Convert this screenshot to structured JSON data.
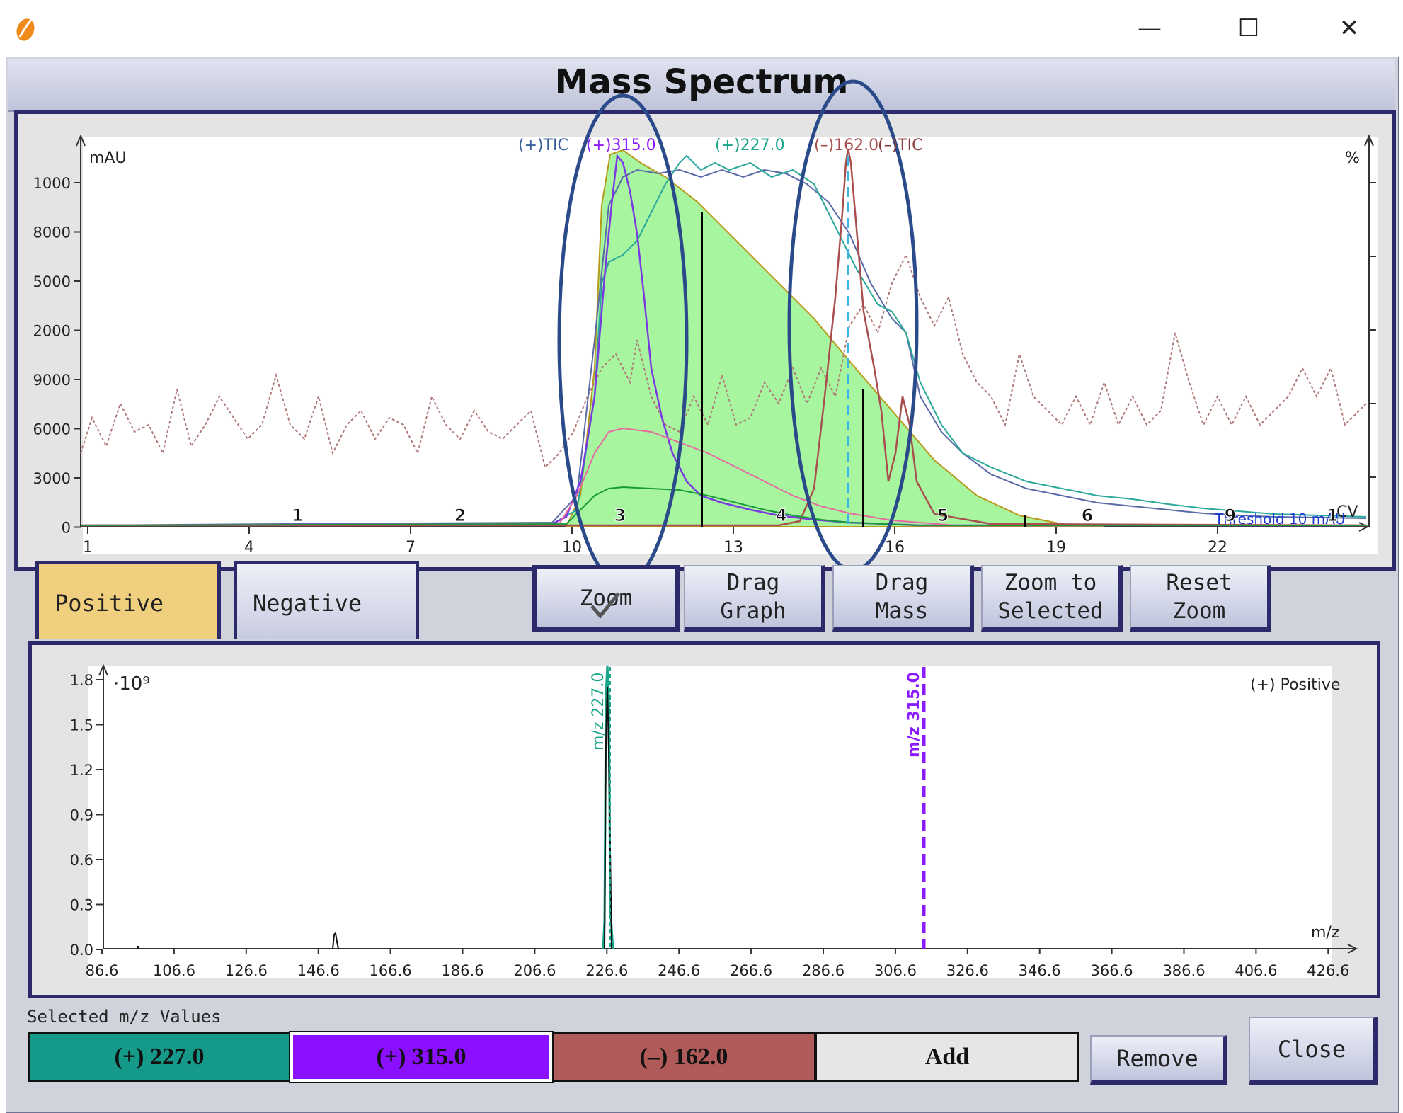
{
  "window": {
    "title": "Mass Spectrum",
    "min_glyph": "—",
    "max_glyph": "☐",
    "close_glyph": "✕"
  },
  "chromatogram": {
    "y_unit_left": "mAU",
    "y_unit_right": "%",
    "x_unit": "CV",
    "y_tick_labels": [
      "1000",
      "8000",
      "5000",
      "2000",
      "9000",
      "6000",
      "3000",
      "0"
    ],
    "x_tick_labels": [
      "1",
      "4",
      "7",
      "10",
      "13",
      "16",
      "19",
      "22"
    ],
    "fraction_labels": [
      "1",
      "2",
      "3",
      "4",
      "5",
      "6",
      "9",
      "1"
    ],
    "traces": [
      {
        "label": "(+)TIC",
        "color": "#3a5f9a"
      },
      {
        "label": "(+)315.0",
        "color": "#8a1aff"
      },
      {
        "label": "(+)227.0",
        "color": "#1aa58a"
      },
      {
        "label": "(–)162.0",
        "color": "#a84e4e"
      },
      {
        "label": "(–)TIC",
        "color": "#8a3a3a"
      }
    ],
    "threshold_label": "Threshold 10 mAU"
  },
  "tabs": {
    "positive": "Positive",
    "negative": "Negative"
  },
  "toolbar": {
    "zoom": "Zoom",
    "drag_graph": "Drag\nGraph",
    "drag_mass": "Drag\nMass",
    "zoom_to_selected": "Zoom to\nSelected",
    "reset_zoom": "Reset\nZoom"
  },
  "spectrum": {
    "y_multiplier": "·10⁹",
    "y_tick_labels": [
      "1.8",
      "1.5",
      "1.2",
      "0.9",
      "0.6",
      "0.3",
      "0.0"
    ],
    "x_tick_labels": [
      "86.6",
      "106.6",
      "126.6",
      "146.6",
      "166.6",
      "186.6",
      "206.6",
      "226.6",
      "246.6",
      "266.6",
      "286.6",
      "306.6",
      "326.6",
      "346.6",
      "366.6",
      "386.6",
      "406.6",
      "426.6"
    ],
    "x_unit": "m/z",
    "mode_label": "(+) Positive",
    "marker_227": "m/z 227.0",
    "marker_315": "m/z 315.0"
  },
  "selected": {
    "label": "Selected m/z Values",
    "values": [
      {
        "text": "(+) 227.0",
        "color": "#159a8a"
      },
      {
        "text": "(+) 315.0",
        "color": "#8a10ff"
      },
      {
        "text": "(–) 162.0",
        "color": "#b05a5a"
      }
    ],
    "add": "Add",
    "remove": "Remove",
    "close": "Close"
  }
}
